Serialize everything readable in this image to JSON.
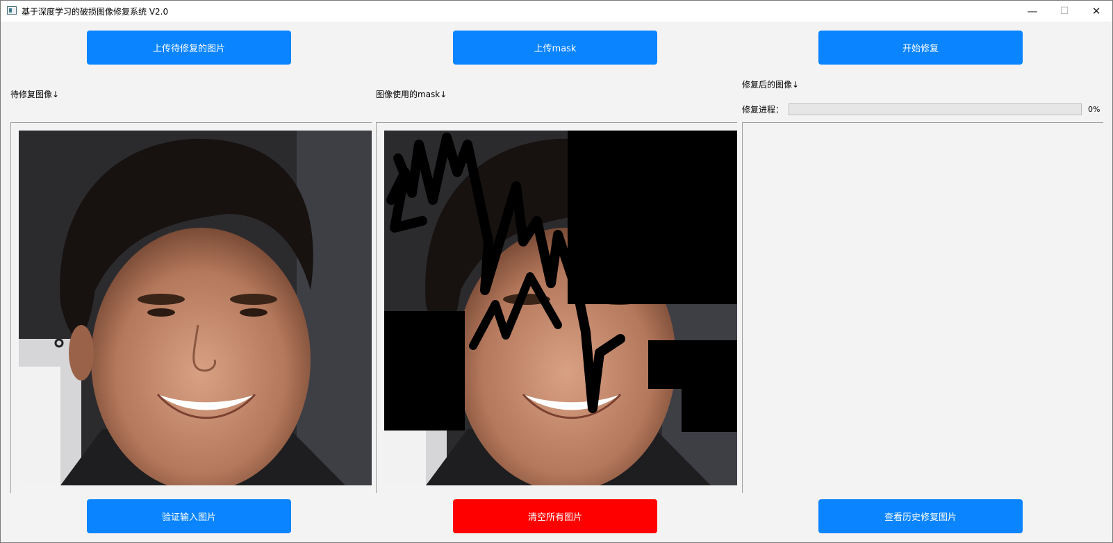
{
  "window": {
    "title": "基于深度学习的破损图像修复系统 V2.0",
    "controls": {
      "minimize": "—",
      "maximize": "☐",
      "close": "✕"
    }
  },
  "top_buttons": {
    "upload_image": "上传待修复的图片",
    "upload_mask": "上传mask",
    "start_repair": "开始修复"
  },
  "panels": {
    "input_label": "待修复图像↓",
    "mask_label": "图像使用的mask↓",
    "output_label": "修复后的图像↓"
  },
  "progress": {
    "label": "修复进程：",
    "value": 0,
    "text": "0%"
  },
  "bottom_buttons": {
    "verify": "验证输入图片",
    "clear": "清空所有图片",
    "history": "查看历史修复图片"
  },
  "colors": {
    "primary_button": "#0a84ff",
    "danger_button": "#ff0000",
    "background": "#f3f3f3"
  }
}
